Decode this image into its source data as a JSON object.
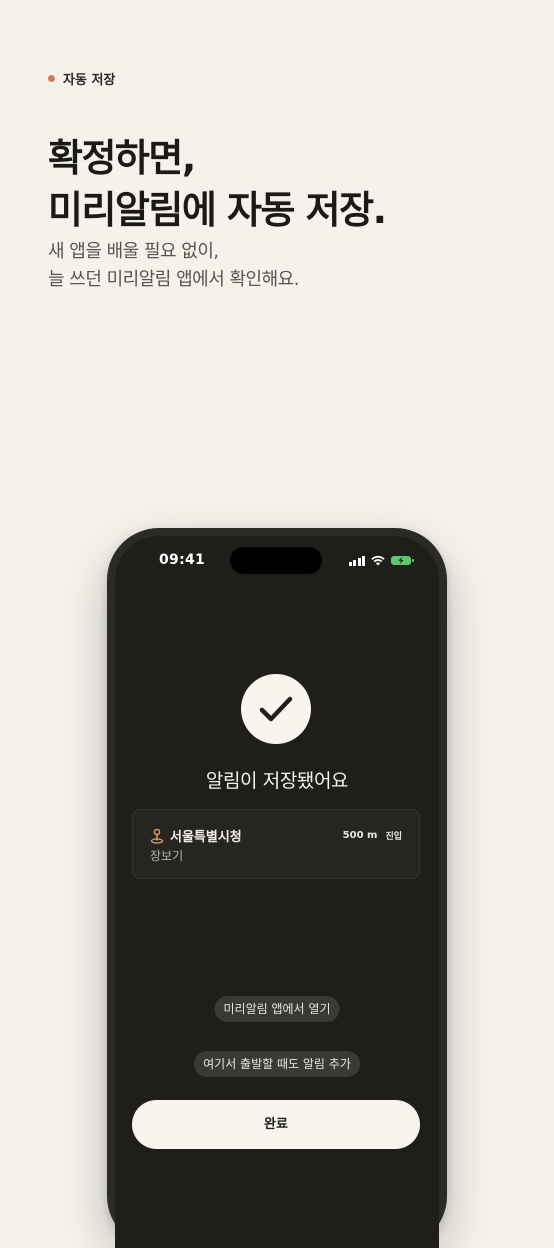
{
  "eyebrow": {
    "label": "자동 저장",
    "dot_color": "#d8785b"
  },
  "headline": {
    "line1": "확정하면,",
    "line2": "미리알림에 자동 저장."
  },
  "subtitle": {
    "line1": "새 앱을 배울 필요 없이,",
    "line2": "늘 쓰던 미리알림 앱에서 확인해요."
  },
  "phone": {
    "status_bar": {
      "time": "09:41",
      "icons": [
        "cellular-signal-icon",
        "wifi-icon",
        "battery-charging-icon"
      ]
    },
    "confirmation": {
      "icon": "checkmark-icon",
      "title": "알림이 저장됐어요"
    },
    "reminder_card": {
      "icon": "location-pin-icon",
      "place": "서울특별시청",
      "distance": "500 m",
      "trigger": "진입",
      "list": "장보기"
    },
    "actions": {
      "open_app": "미리알림 앱에서 열기",
      "add_departure": "여기서 출발할 때도 알림 추가",
      "done": "완료"
    }
  },
  "colors": {
    "background": "#f4f2ea",
    "accent": "#d8785b",
    "screen": "#1f1e1b",
    "battery": "#5ec86a"
  }
}
